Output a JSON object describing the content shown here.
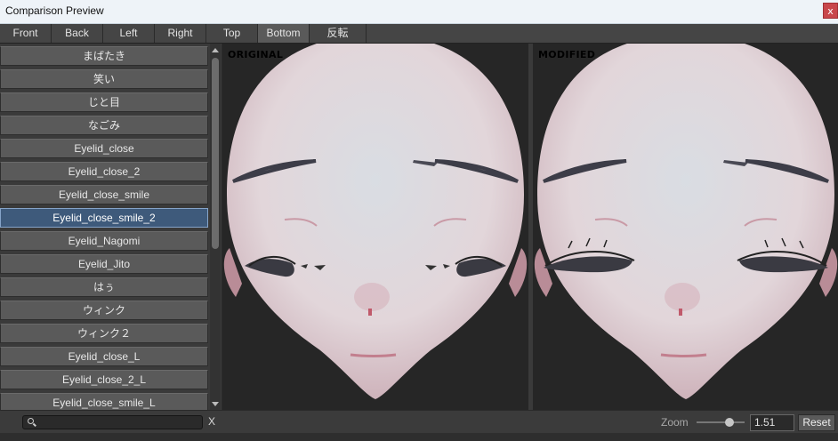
{
  "window": {
    "title": "Comparison Preview",
    "close_label": "x"
  },
  "tabs": [
    {
      "label": "Front"
    },
    {
      "label": "Back"
    },
    {
      "label": "Left"
    },
    {
      "label": "Right"
    },
    {
      "label": "Top"
    },
    {
      "label": "Bottom"
    },
    {
      "label": "反転"
    }
  ],
  "active_tab": "Bottom",
  "list": {
    "items": [
      {
        "label": "まばたき"
      },
      {
        "label": "笑い"
      },
      {
        "label": "じと目"
      },
      {
        "label": "なごみ"
      },
      {
        "label": "Eyelid_close"
      },
      {
        "label": "Eyelid_close_2"
      },
      {
        "label": "Eyelid_close_smile"
      },
      {
        "label": "Eyelid_close_smile_2"
      },
      {
        "label": "Eyelid_Nagomi"
      },
      {
        "label": "Eyelid_Jito"
      },
      {
        "label": "はぅ"
      },
      {
        "label": "ウィンク"
      },
      {
        "label": "ウィンク２"
      },
      {
        "label": "Eyelid_close_L"
      },
      {
        "label": "Eyelid_close_2_L"
      },
      {
        "label": "Eyelid_close_smile_L"
      }
    ],
    "selected": "Eyelid_close_smile_2"
  },
  "viewports": {
    "original_label": "ORIGINAL",
    "modified_label": "MODIFIED"
  },
  "search": {
    "value": "",
    "clear_label": "X"
  },
  "zoom": {
    "label": "Zoom",
    "value": "1.51",
    "reset_label": "Reset"
  },
  "colors": {
    "accent_selected": "#3e5a7b",
    "close_button": "#c8474b",
    "face_skin": "#e7dde0",
    "background": "#262626"
  }
}
